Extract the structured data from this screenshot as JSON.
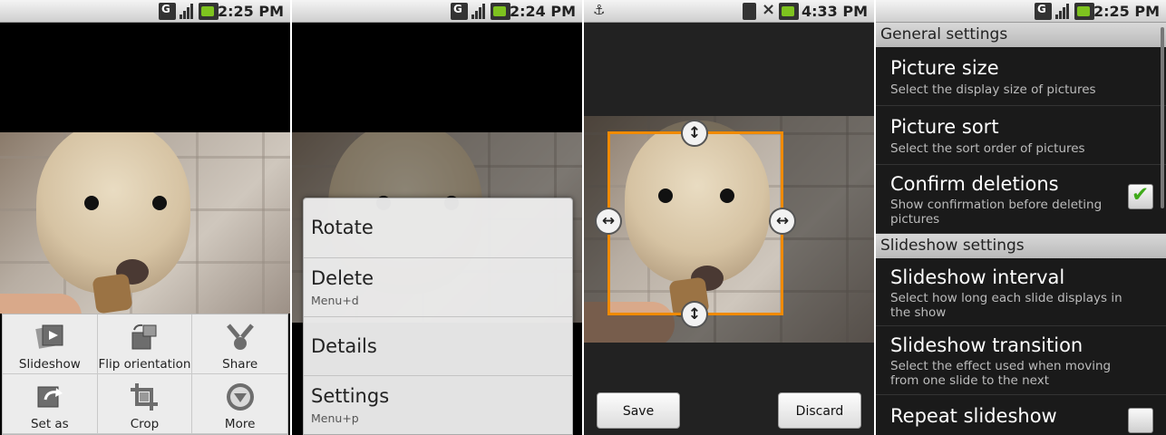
{
  "screens": {
    "gallery_view": {
      "status_time": "2:25 PM",
      "menu": [
        {
          "label": "Slideshow",
          "icon": "slideshow-icon"
        },
        {
          "label": "Flip orientation",
          "icon": "flip-orientation-icon"
        },
        {
          "label": "Share",
          "icon": "share-icon"
        },
        {
          "label": "Set as",
          "icon": "set-as-icon"
        },
        {
          "label": "Crop",
          "icon": "crop-icon"
        },
        {
          "label": "More",
          "icon": "more-icon"
        }
      ]
    },
    "context_menu": {
      "status_time": "2:24 PM",
      "items": [
        {
          "title": "Rotate",
          "shortcut": ""
        },
        {
          "title": "Delete",
          "shortcut": "Menu+d"
        },
        {
          "title": "Details",
          "shortcut": ""
        },
        {
          "title": "Settings",
          "shortcut": "Menu+p"
        }
      ]
    },
    "crop": {
      "status_time": "4:33 PM",
      "save_label": "Save",
      "discard_label": "Discard",
      "crop_color": "#f08a00"
    },
    "settings": {
      "status_time": "2:25 PM",
      "general_header": "General settings",
      "slideshow_header": "Slideshow settings",
      "general": [
        {
          "title": "Picture size",
          "summary": "Select the display size of pictures"
        },
        {
          "title": "Picture sort",
          "summary": "Select the sort order of pictures"
        },
        {
          "title": "Confirm deletions",
          "summary": "Show confirmation before deleting pictures",
          "checked": true
        }
      ],
      "slideshow": [
        {
          "title": "Slideshow interval",
          "summary": "Select how long each slide displays in the show"
        },
        {
          "title": "Slideshow transition",
          "summary": "Select the effect used when moving from one slide to the next"
        },
        {
          "title": "Repeat slideshow",
          "checked": false
        }
      ]
    }
  }
}
